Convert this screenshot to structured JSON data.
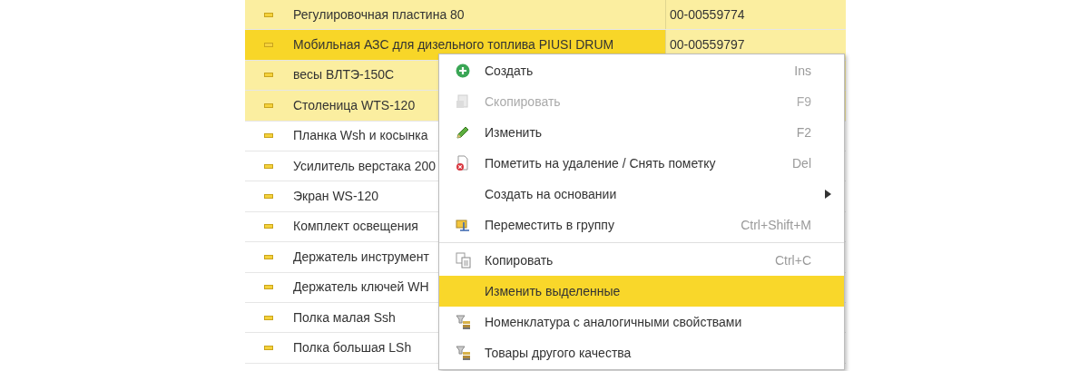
{
  "table": {
    "rows": [
      {
        "name": "Регулировочная пластина 80",
        "code": "00-00559774",
        "selected": true,
        "current": false
      },
      {
        "name": "Мобильная АЗС для дизельного топлива PIUSI DRUM",
        "code": "00-00559797",
        "selected": true,
        "current": true
      },
      {
        "name": "весы ВЛТЭ-150С",
        "selected": true,
        "current": false
      },
      {
        "name": "Столеница WTS-120",
        "selected": true,
        "current": false
      },
      {
        "name": "Планка Wsh и косынка",
        "selected": false,
        "current": false
      },
      {
        "name": "Усилитель верстака 200",
        "selected": false,
        "current": false
      },
      {
        "name": "Экран WS-120",
        "selected": false,
        "current": false
      },
      {
        "name": "Комплект освещения",
        "selected": false,
        "current": false
      },
      {
        "name": "Держатель инструмент",
        "selected": false,
        "current": false
      },
      {
        "name": "Держатель ключей WH",
        "selected": false,
        "current": false
      },
      {
        "name": "Полка малая Ssh",
        "selected": false,
        "current": false
      },
      {
        "name": "Полка большая LSh",
        "selected": false,
        "current": false
      }
    ]
  },
  "context_menu": {
    "items": [
      {
        "kind": "item",
        "label": "Создать",
        "shortcut": "Ins",
        "disabled": false,
        "selected": false
      },
      {
        "kind": "item",
        "label": "Скопировать",
        "shortcut": "F9",
        "disabled": true,
        "selected": false
      },
      {
        "kind": "item",
        "label": "Изменить",
        "shortcut": "F2",
        "disabled": false,
        "selected": false
      },
      {
        "kind": "item",
        "label": "Пометить на удаление / Снять пометку",
        "shortcut": "Del",
        "disabled": false,
        "selected": false
      },
      {
        "kind": "submenu",
        "label": "Создать на основании",
        "disabled": false,
        "selected": false
      },
      {
        "kind": "item",
        "label": "Переместить в группу",
        "shortcut": "Ctrl+Shift+M",
        "disabled": false,
        "selected": false
      },
      {
        "kind": "separator"
      },
      {
        "kind": "item",
        "label": "Копировать",
        "shortcut": "Ctrl+C",
        "disabled": false,
        "selected": false
      },
      {
        "kind": "item",
        "label": "Изменить выделенные",
        "disabled": false,
        "selected": true
      },
      {
        "kind": "item",
        "label": "Номенклатура с аналогичными свойствами",
        "disabled": false,
        "selected": false
      },
      {
        "kind": "item",
        "label": "Товары другого качества",
        "disabled": false,
        "selected": false
      }
    ]
  }
}
